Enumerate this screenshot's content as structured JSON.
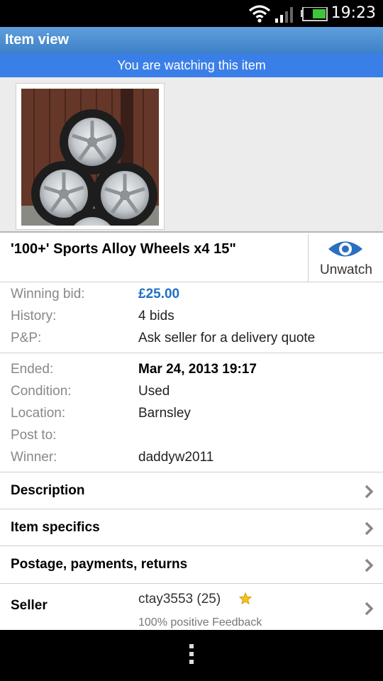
{
  "status_bar": {
    "time": "19:23",
    "icons": [
      "wifi-icon",
      "signal-icon",
      "battery-icon"
    ]
  },
  "action_bar": {
    "title": "Item view"
  },
  "watch_banner": "You are watching this item",
  "item": {
    "title": "'100+' Sports Alloy Wheels x4 15\"",
    "unwatch_label": "Unwatch"
  },
  "bid_info": [
    {
      "label": "Winning bid:",
      "value": "£25.00"
    },
    {
      "label": "History:",
      "value": "4 bids"
    },
    {
      "label": "P&P:",
      "value": "Ask seller for a delivery quote"
    }
  ],
  "listing_info": [
    {
      "label": "Ended:",
      "value": "Mar 24, 2013 19:17"
    },
    {
      "label": "Condition:",
      "value": "Used"
    },
    {
      "label": "Location:",
      "value": "Barnsley"
    },
    {
      "label": "Post to:",
      "value": ""
    },
    {
      "label": "Winner:",
      "value": "daddyw2011"
    }
  ],
  "sections": [
    {
      "label": "Description"
    },
    {
      "label": "Item specifics"
    },
    {
      "label": "Postage, payments, returns"
    }
  ],
  "seller": {
    "label": "Seller",
    "name": "ctay3553 (25)",
    "feedback": "100% positive Feedback"
  },
  "colors": {
    "accent": "#3a7fe8",
    "bid": "#1f6fc6",
    "actionbar": "#4a8ad0"
  }
}
